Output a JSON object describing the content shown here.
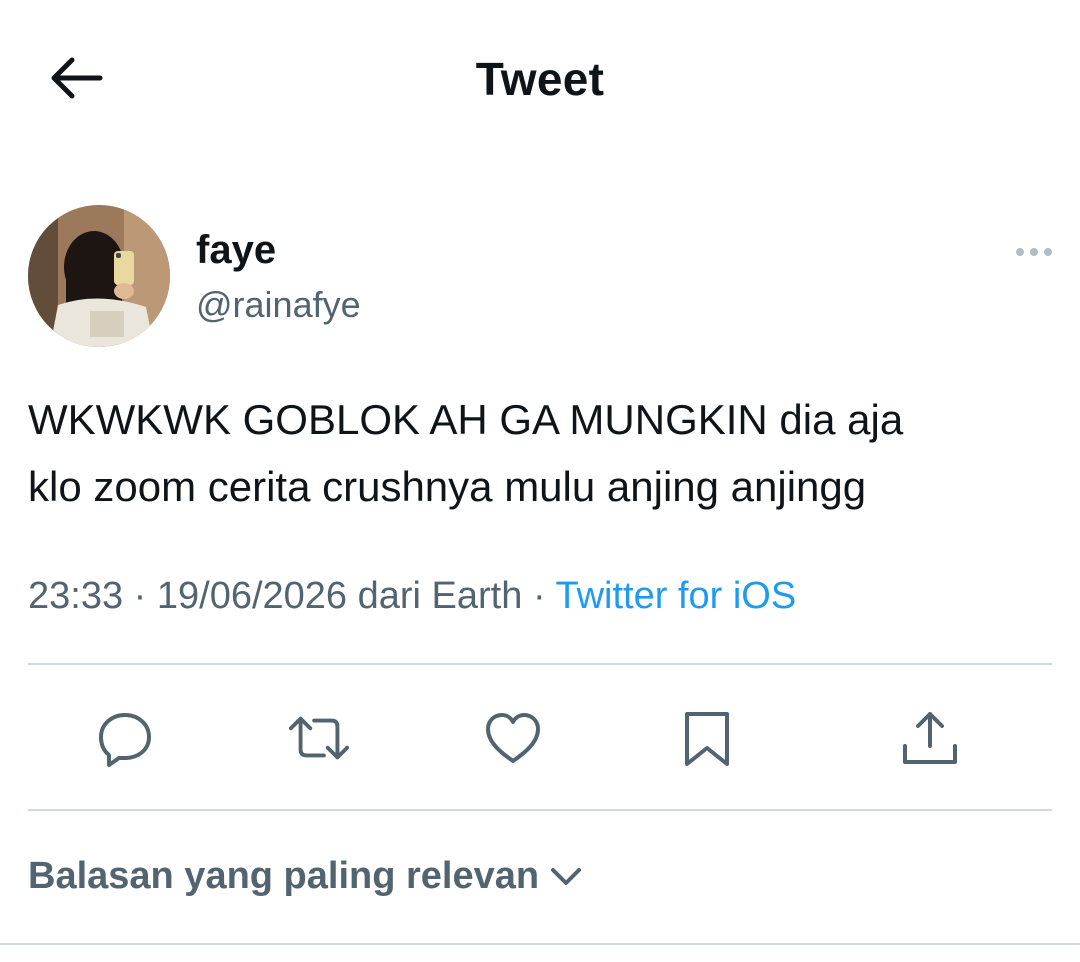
{
  "header": {
    "title": "Tweet",
    "back_icon": "arrow-left-icon"
  },
  "tweet": {
    "author": {
      "name": "faye",
      "handle": "@rainafye"
    },
    "text_lines": [
      "WKWKWK GOBLOK AH GA MUNGKIN dia aja",
      "klo zoom cerita crushnya mulu anjing anjingg"
    ],
    "meta": {
      "time": "23:33",
      "separator": "·",
      "date": "19/06/2026",
      "location": "dari Earth",
      "source": "Twitter for iOS"
    },
    "more_icon": "more-horizontal-icon"
  },
  "actions": [
    {
      "name": "reply",
      "icon": "reply-icon"
    },
    {
      "name": "retweet",
      "icon": "retweet-icon"
    },
    {
      "name": "like",
      "icon": "heart-icon"
    },
    {
      "name": "bookmark",
      "icon": "bookmark-icon"
    },
    {
      "name": "share",
      "icon": "share-icon"
    }
  ],
  "replies": {
    "sort_label": "Balasan yang paling relevan",
    "sort_icon": "chevron-down-icon"
  },
  "colors": {
    "text": "#0f1419",
    "secondary": "#536471",
    "link": "#1d9bf0",
    "divider": "#cfd9de"
  }
}
